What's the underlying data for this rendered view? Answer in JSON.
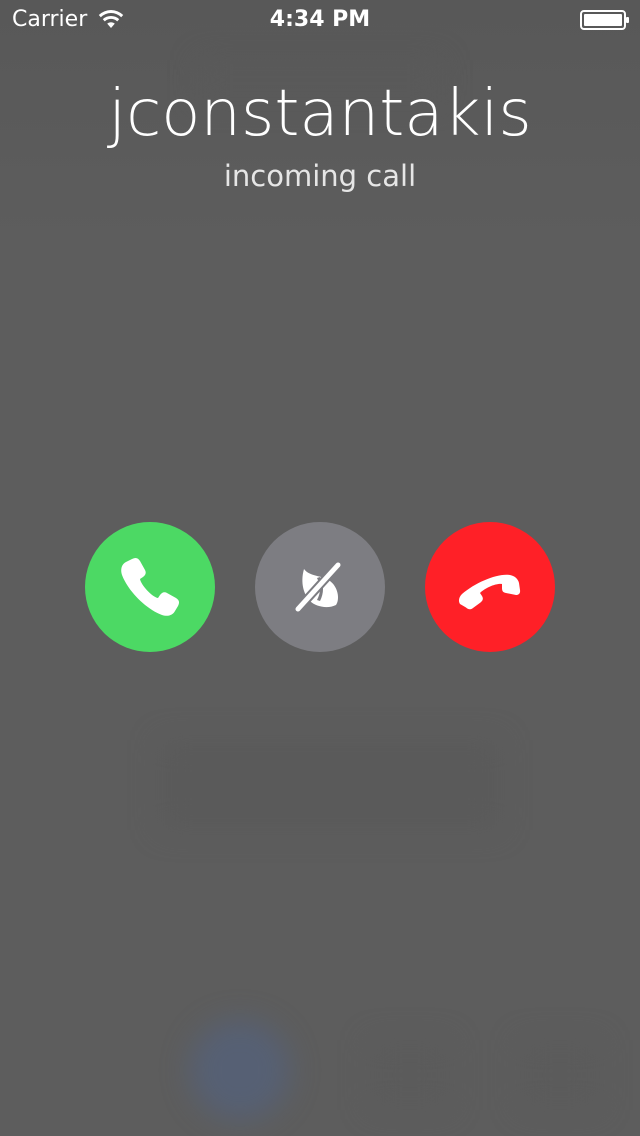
{
  "status_bar": {
    "carrier": "Carrier",
    "time": "4:34 PM",
    "wifi_icon": "wifi-icon",
    "battery_icon": "battery-full-icon"
  },
  "call": {
    "caller_name": "jconstantakis",
    "status": "incoming call"
  },
  "actions": {
    "accept": {
      "icon": "phone-accept-icon",
      "color": "#4cd964"
    },
    "silence": {
      "icon": "silence-ringer-icon",
      "color": "#7d7d82"
    },
    "decline": {
      "icon": "phone-decline-icon",
      "color": "#ff2027"
    }
  },
  "colors": {
    "background": "#5d5d5d",
    "text": "#ffffff"
  }
}
